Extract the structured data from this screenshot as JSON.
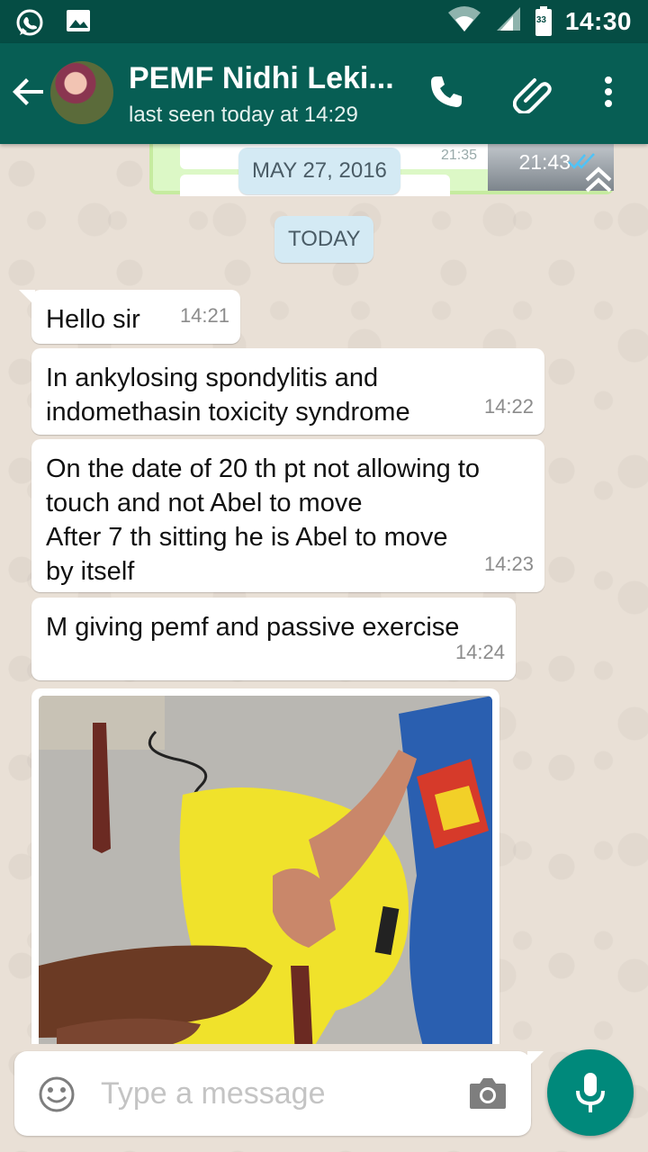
{
  "status_bar": {
    "time": "14:30",
    "battery_level": "33"
  },
  "header": {
    "contact_name": "PEMF Nidhi Leki...",
    "last_seen": "last seen today at 14:29"
  },
  "previous_message": {
    "time": "21:43",
    "inner_time": "21:35"
  },
  "date_labels": {
    "previous_date": "MAY 27, 2016",
    "today": "TODAY"
  },
  "messages": [
    {
      "text": "Hello sir",
      "time": "14:21"
    },
    {
      "text": "In ankylosing spondylitis and\nindomethasin toxicity syndrome",
      "time": "14:22"
    },
    {
      "text": "On the date of 20 th pt not allowing to\ntouch and not Abel to move\nAfter 7 th sitting he is Abel to move\nby itself",
      "time": "14:23"
    },
    {
      "text": "M giving pemf and passive exercise",
      "time": "14:24"
    }
  ],
  "composer": {
    "placeholder": "Type a message"
  },
  "colors": {
    "toolbar": "#075e54",
    "status_bar": "#054d44",
    "fab": "#00897b",
    "date_chip": "#d4eaf4",
    "outgoing_bubble": "#dcf8c6",
    "read_ticks": "#4fc3f7"
  }
}
